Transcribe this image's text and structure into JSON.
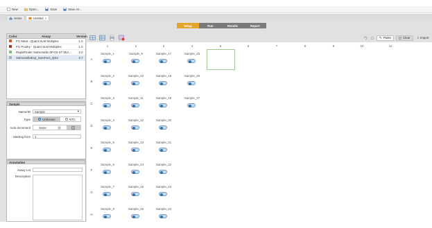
{
  "toolbar": {
    "new_label": "New",
    "open_label": "Open...",
    "save_label": "Save",
    "saveas_label": "Save As..."
  },
  "tabs": [
    {
      "label": "Home"
    },
    {
      "label": "Untitled"
    }
  ],
  "steps": [
    "Setup",
    "Run",
    "Results",
    "Report"
  ],
  "assay_table": {
    "headers": [
      "Color",
      "Assay",
      "Version"
    ],
    "rows": [
      {
        "color": "#d4532b",
        "name": "FG Meat - Quant SLM Multiplex",
        "version": "1.0"
      },
      {
        "color": "#b0341c",
        "name": "FG Poultry - Quant SLM Multiplex",
        "version": "1.0"
      },
      {
        "color": "#7bc37b",
        "name": "RapidFinder Salmonella SP-03-ST Mul...",
        "version": "2.0"
      },
      {
        "color": "#9fb0c3",
        "name": "SalmonellaExp_SureFect_QS3",
        "version": "2.7"
      }
    ]
  },
  "sample": {
    "title": "Sample",
    "name_label": "Name/ID",
    "name_value": "Sample",
    "type_label": "Type",
    "type_unknown": "Unknown",
    "type_ntc": "NTC",
    "auto_label": "Auto-increment",
    "auto_none": "None",
    "start_label": "Starting from",
    "start_value": "1"
  },
  "annotation": {
    "title": "Annotation",
    "assay_lot_label": "Assay Lot",
    "description_label": "Description"
  },
  "plate_tools": {
    "paste_label": "Paste",
    "clear_label": "Clear",
    "import_label": "Import"
  },
  "plate": {
    "columns": [
      "1",
      "2",
      "3",
      "4",
      "5",
      "6",
      "7",
      "8",
      "9",
      "10",
      "11"
    ],
    "rows": [
      "A",
      "B",
      "C",
      "D",
      "E",
      "F",
      "G",
      "H"
    ],
    "wells": [
      [
        "Sample_1",
        "Sample_9",
        "Sample_17",
        "Sample_25"
      ],
      [
        "Sample_2",
        "Sample_10",
        "Sample_18",
        "Sample_26"
      ],
      [
        "Sample_3",
        "Sample_11",
        "Sample_19",
        "Sample_27"
      ],
      [
        "Sample_4",
        "Sample_12",
        "Sample_20",
        ""
      ],
      [
        "Sample_5",
        "Sample_13",
        "Sample_21",
        ""
      ],
      [
        "Sample_6",
        "Sample_14",
        "Sample_22",
        ""
      ],
      [
        "Sample_7",
        "Sample_15",
        "Sample_23",
        ""
      ],
      [
        "Sample_8",
        "Sample_16",
        "Sample_24",
        ""
      ]
    ]
  }
}
